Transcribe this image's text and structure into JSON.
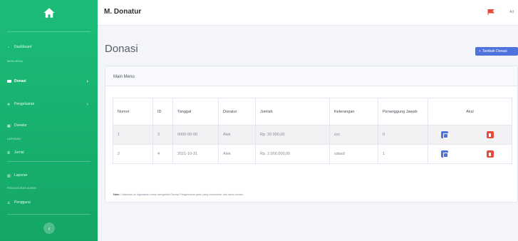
{
  "sidebar": {
    "items": [
      {
        "label": "Dashboard",
        "icon": "tachometer-icon"
      },
      {
        "label": "Donasi",
        "icon": "folder-icon",
        "active": true
      },
      {
        "label": "Pengeluaran",
        "icon": "cog-icon"
      },
      {
        "label": "Donatur",
        "icon": "table-icon"
      },
      {
        "label": "Jurnal",
        "icon": "list-icon"
      },
      {
        "label": "Laporan",
        "icon": "chart-icon"
      },
      {
        "label": "Pengguna",
        "icon": "user-icon"
      }
    ],
    "headings": [
      "MAIN MENU",
      "LAPORAN",
      "PENGATURAN ADMIN"
    ],
    "accent": "#1cbd79"
  },
  "topbar": {
    "title": "M. Donatur",
    "user_label": "Ad"
  },
  "page": {
    "title": "Donasi",
    "add_button_label": "Tambah Donasi"
  },
  "card": {
    "header": "Main Menu",
    "table": {
      "columns": [
        "Nomor",
        "ID",
        "Tanggal",
        "Donatur",
        "Jumlah",
        "Keterangan",
        "Penanggung Jawab",
        "Aksi"
      ],
      "rows": [
        [
          "1",
          "3",
          "0000-00-00",
          "Alek",
          "Rp. 20.000,00",
          "zxc",
          "0"
        ],
        [
          "2",
          "4",
          "2021-10-31",
          "Alek",
          "Rp. 2.000.000,00",
          "sdasd",
          "1"
        ]
      ]
    },
    "note_label": "Note :",
    "note_text": "Halaman ini digunakan untuk mengelola Donasi Pengeluaran panti yang bersumber dari dana donasi."
  },
  "colors": {
    "primary": "#4e73df",
    "danger": "#e74a3b",
    "sidebar": "#1cbd79"
  }
}
